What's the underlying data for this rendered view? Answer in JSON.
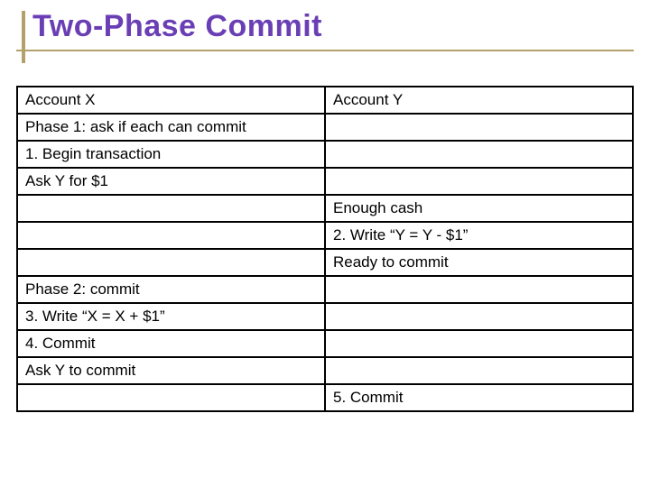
{
  "title": "Two-Phase Commit",
  "table": {
    "rows": [
      {
        "left": "Account X",
        "right": "Account Y"
      },
      {
        "left": "Phase 1:  ask if each can commit",
        "right": ""
      },
      {
        "left": "1.  Begin transaction",
        "right": ""
      },
      {
        "left": "Ask Y for $1",
        "right": ""
      },
      {
        "left": "",
        "right": "Enough cash"
      },
      {
        "left": "",
        "right": "2.  Write “Y = Y - $1”"
      },
      {
        "left": "",
        "right": "Ready to commit"
      },
      {
        "left": "Phase 2:  commit",
        "right": ""
      },
      {
        "left": "3.  Write “X = X + $1”",
        "right": ""
      },
      {
        "left": "4.  Commit",
        "right": ""
      },
      {
        "left": "Ask Y to commit",
        "right": ""
      },
      {
        "left": "",
        "right": "5.  Commit"
      }
    ]
  }
}
